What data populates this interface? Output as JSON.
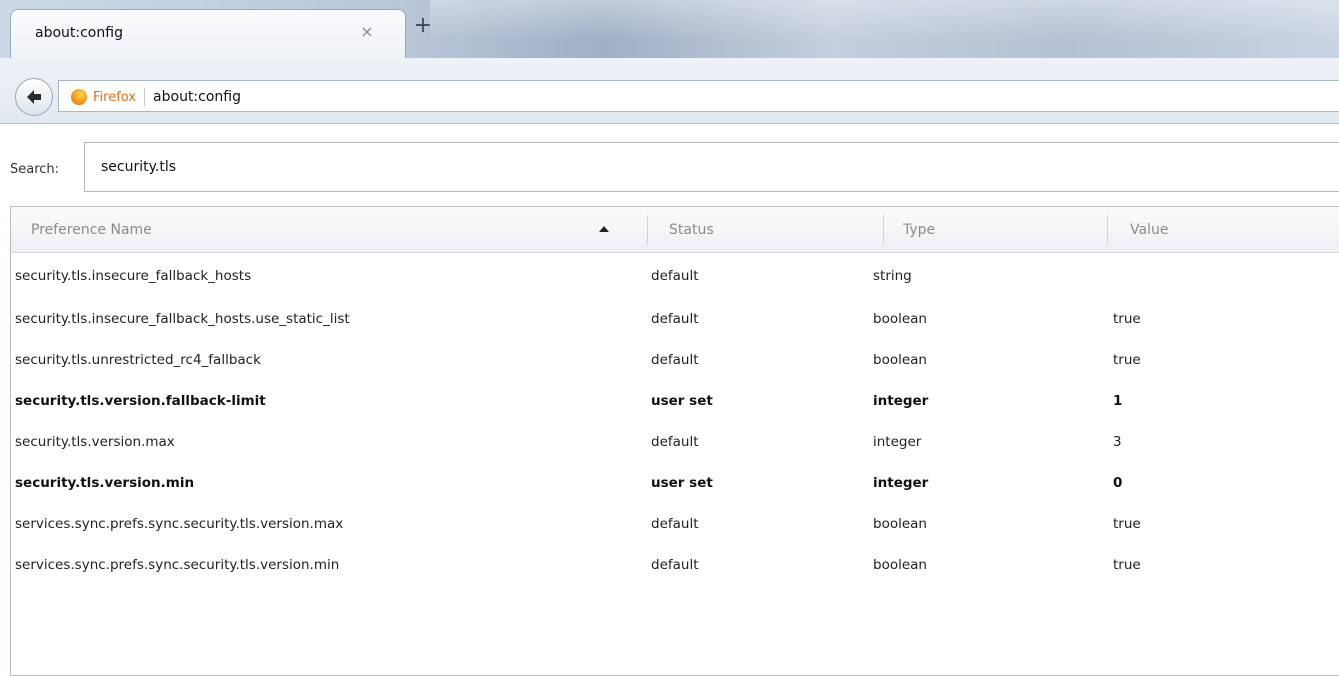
{
  "tab": {
    "title": "about:config",
    "close_glyph": "×",
    "new_tab_glyph": "+"
  },
  "navbar": {
    "identity_label": "Firefox",
    "url": "about:config",
    "back_icon": "back-arrow-icon",
    "identity_icon": "firefox-icon"
  },
  "search": {
    "label": "Search:",
    "value": "security.tls"
  },
  "columns": {
    "name": "Preference Name",
    "status": "Status",
    "type": "Type",
    "value": "Value"
  },
  "rows": [
    {
      "name": "security.tls.insecure_fallback_hosts",
      "status": "default",
      "type": "string",
      "value": "",
      "user_set": false
    },
    {
      "name": "security.tls.insecure_fallback_hosts.use_static_list",
      "status": "default",
      "type": "boolean",
      "value": "true",
      "user_set": false
    },
    {
      "name": "security.tls.unrestricted_rc4_fallback",
      "status": "default",
      "type": "boolean",
      "value": "true",
      "user_set": false
    },
    {
      "name": "security.tls.version.fallback-limit",
      "status": "user set",
      "type": "integer",
      "value": "1",
      "user_set": true
    },
    {
      "name": "security.tls.version.max",
      "status": "default",
      "type": "integer",
      "value": "3",
      "user_set": false
    },
    {
      "name": "security.tls.version.min",
      "status": "user set",
      "type": "integer",
      "value": "0",
      "user_set": true
    },
    {
      "name": "services.sync.prefs.sync.security.tls.version.max",
      "status": "default",
      "type": "boolean",
      "value": "true",
      "user_set": false
    },
    {
      "name": "services.sync.prefs.sync.security.tls.version.min",
      "status": "default",
      "type": "boolean",
      "value": "true",
      "user_set": false
    }
  ],
  "colors": {
    "identity_label": "#d3711a",
    "header_text": "#8c8c8c"
  }
}
